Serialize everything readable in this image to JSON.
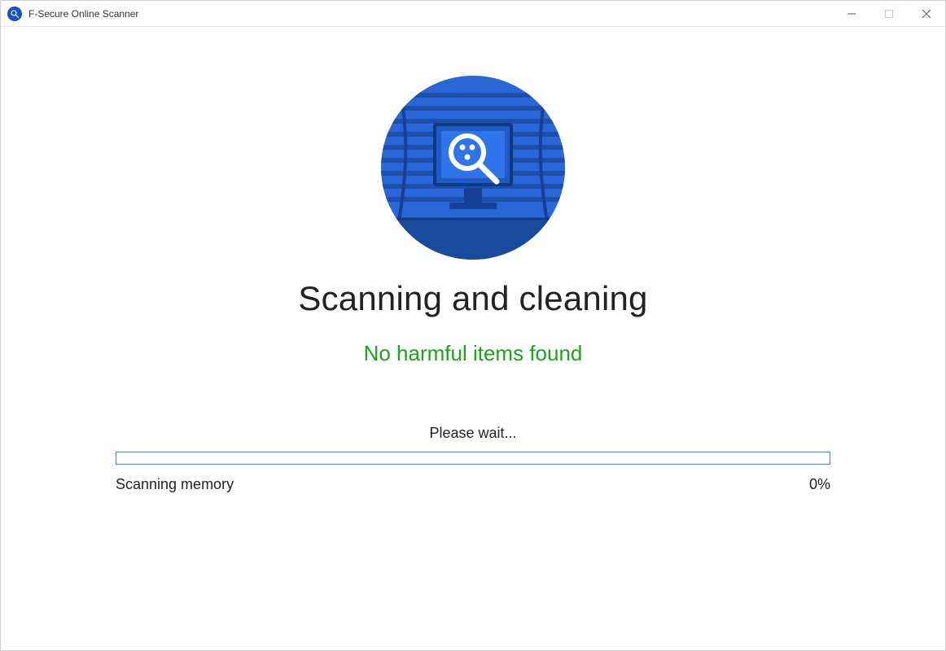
{
  "window": {
    "title": "F-Secure Online Scanner"
  },
  "main": {
    "heading": "Scanning and cleaning",
    "status": "No harmful items found",
    "wait": "Please wait...",
    "task": "Scanning memory",
    "percent_label": "0%",
    "percent_value": 0
  },
  "colors": {
    "accent": "#3b82f6",
    "success": "#1aa41a",
    "icon_bg": "#1852c4"
  }
}
